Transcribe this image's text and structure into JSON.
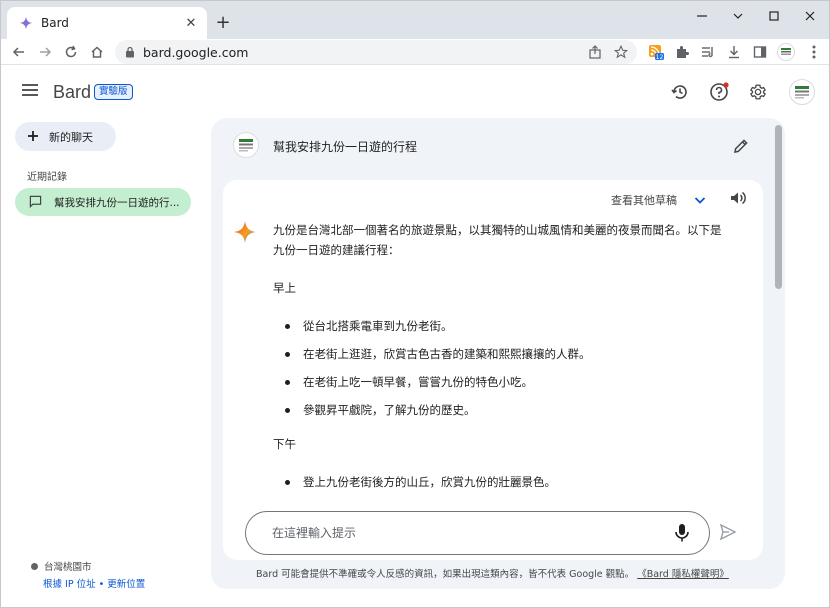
{
  "browser": {
    "tab_title": "Bard",
    "url": "bard.google.com",
    "extension_badge": "12"
  },
  "app": {
    "brand": "Bard",
    "badge": "實驗版"
  },
  "sidebar": {
    "new_chat_label": "新的聊天",
    "recent_title": "近期記錄",
    "recent_items": [
      {
        "label": "幫我安排九份一日遊的行..."
      }
    ],
    "location_name": "台灣桃園市",
    "location_link_ip": "根據 IP 位址",
    "location_separator": " • ",
    "location_link_update": "更新位置"
  },
  "conversation": {
    "prompt": "幫我安排九份一日遊的行程",
    "drafts_label": "查看其他草稿",
    "response": {
      "intro": "九份是台灣北部一個著名的旅遊景點，以其獨特的山城風情和美麗的夜景而聞名。以下是九份一日遊的建議行程：",
      "morning_heading": "早上",
      "morning_items": [
        "從台北搭乘電車到九份老街。",
        "在老街上逛逛，欣賞古色古香的建築和熙熙攘攘的人群。",
        "在老街上吃一頓早餐，嘗嘗九份的特色小吃。",
        "參觀昇平戲院，了解九份的歷史。"
      ],
      "afternoon_heading": "下午",
      "afternoon_items": [
        "登上九份老街後方的山丘，欣賞九份的壯麗景色。"
      ]
    }
  },
  "input": {
    "placeholder": "在這裡輸入提示"
  },
  "footer": {
    "disclaimer": "Bard 可能會提供不準確或令人反感的資訊，如果出現這類內容，皆不代表 Google 觀點。",
    "privacy_link": "《Bard 隱私權聲明》"
  },
  "colors": {
    "accent": "#0b57d0",
    "recent_item_bg": "#c4eed0",
    "panel_bg": "#f0f4f9"
  }
}
